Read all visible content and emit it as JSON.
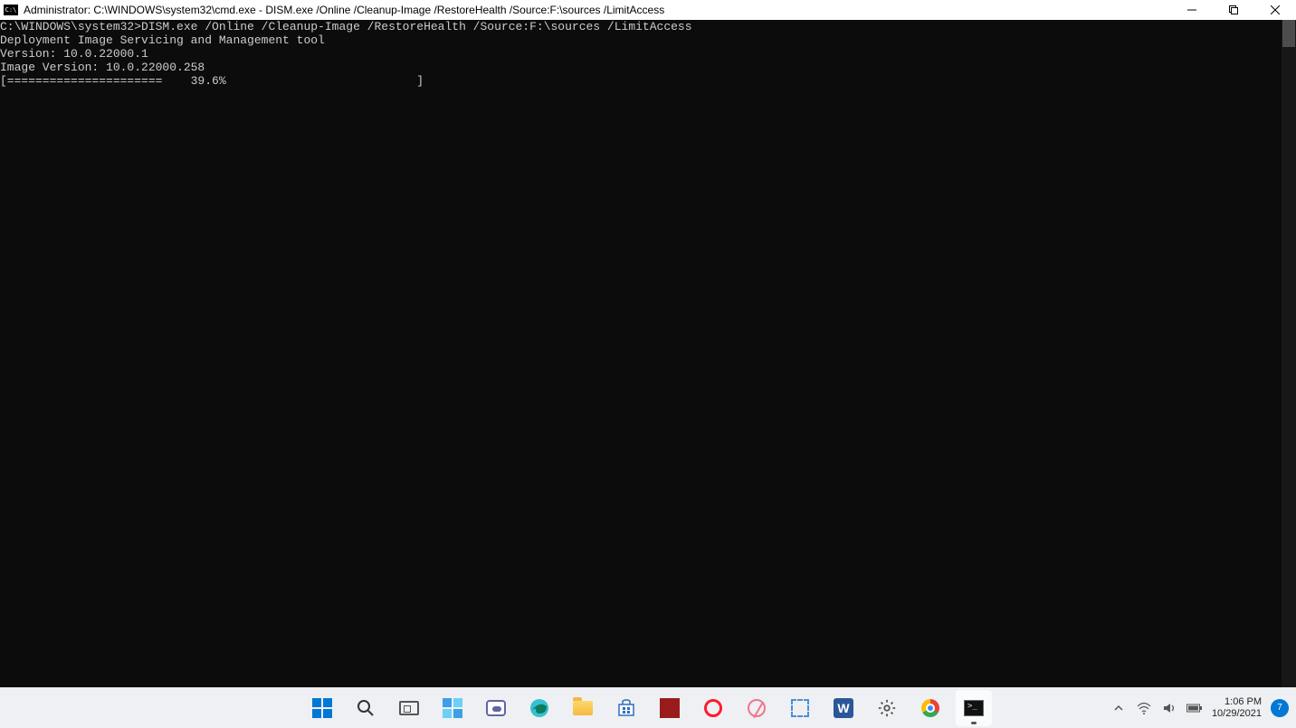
{
  "window": {
    "icon_label": "C:\\",
    "title": "Administrator: C:\\WINDOWS\\system32\\cmd.exe - DISM.exe  /Online /Cleanup-Image /RestoreHealth /Source:F:\\sources /LimitAccess"
  },
  "terminal": {
    "lines": [
      "C:\\WINDOWS\\system32>DISM.exe /Online /Cleanup-Image /RestoreHealth /Source:F:\\sources /LimitAccess",
      "",
      "Deployment Image Servicing and Management tool",
      "Version: 10.0.22000.1",
      "",
      "Image Version: 10.0.22000.258",
      "",
      "[======================    39.6%                           ]"
    ]
  },
  "taskbar": {
    "icons": [
      {
        "name": "start",
        "type": "winlogo"
      },
      {
        "name": "search",
        "type": "search"
      },
      {
        "name": "task-view",
        "type": "taskview"
      },
      {
        "name": "widgets",
        "type": "widgets"
      },
      {
        "name": "chat",
        "type": "chat"
      },
      {
        "name": "edge",
        "type": "edge"
      },
      {
        "name": "file-explorer",
        "type": "folder"
      },
      {
        "name": "microsoft-store",
        "type": "store"
      },
      {
        "name": "app-red",
        "type": "red"
      },
      {
        "name": "opera",
        "type": "opera"
      },
      {
        "name": "app-pink",
        "type": "pink"
      },
      {
        "name": "snip",
        "type": "snip"
      },
      {
        "name": "word",
        "type": "word",
        "label": "W"
      },
      {
        "name": "settings",
        "type": "gear"
      },
      {
        "name": "chrome",
        "type": "chrome"
      },
      {
        "name": "cmd",
        "type": "terminal",
        "active": true
      }
    ]
  },
  "systray": {
    "time": "1:06 PM",
    "date": "10/29/2021",
    "notif_count": "7"
  }
}
